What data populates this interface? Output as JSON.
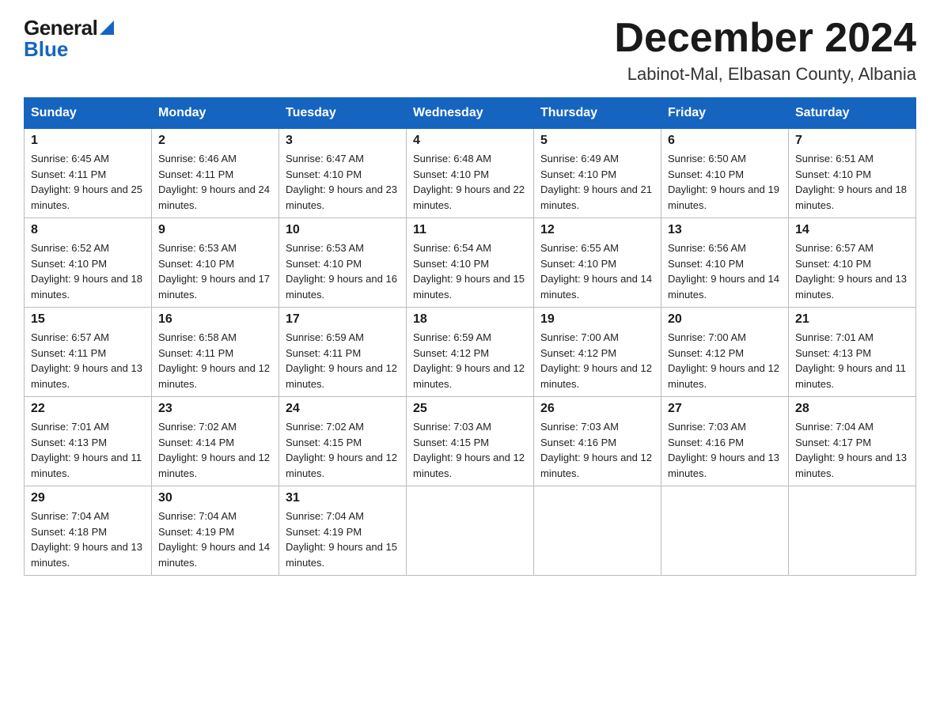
{
  "header": {
    "logo_general": "General",
    "logo_blue": "Blue",
    "month_title": "December 2024",
    "location": "Labinot-Mal, Elbasan County, Albania"
  },
  "calendar": {
    "days_of_week": [
      "Sunday",
      "Monday",
      "Tuesday",
      "Wednesday",
      "Thursday",
      "Friday",
      "Saturday"
    ],
    "weeks": [
      [
        {
          "day": "1",
          "sunrise": "Sunrise: 6:45 AM",
          "sunset": "Sunset: 4:11 PM",
          "daylight": "Daylight: 9 hours and 25 minutes."
        },
        {
          "day": "2",
          "sunrise": "Sunrise: 6:46 AM",
          "sunset": "Sunset: 4:11 PM",
          "daylight": "Daylight: 9 hours and 24 minutes."
        },
        {
          "day": "3",
          "sunrise": "Sunrise: 6:47 AM",
          "sunset": "Sunset: 4:10 PM",
          "daylight": "Daylight: 9 hours and 23 minutes."
        },
        {
          "day": "4",
          "sunrise": "Sunrise: 6:48 AM",
          "sunset": "Sunset: 4:10 PM",
          "daylight": "Daylight: 9 hours and 22 minutes."
        },
        {
          "day": "5",
          "sunrise": "Sunrise: 6:49 AM",
          "sunset": "Sunset: 4:10 PM",
          "daylight": "Daylight: 9 hours and 21 minutes."
        },
        {
          "day": "6",
          "sunrise": "Sunrise: 6:50 AM",
          "sunset": "Sunset: 4:10 PM",
          "daylight": "Daylight: 9 hours and 19 minutes."
        },
        {
          "day": "7",
          "sunrise": "Sunrise: 6:51 AM",
          "sunset": "Sunset: 4:10 PM",
          "daylight": "Daylight: 9 hours and 18 minutes."
        }
      ],
      [
        {
          "day": "8",
          "sunrise": "Sunrise: 6:52 AM",
          "sunset": "Sunset: 4:10 PM",
          "daylight": "Daylight: 9 hours and 18 minutes."
        },
        {
          "day": "9",
          "sunrise": "Sunrise: 6:53 AM",
          "sunset": "Sunset: 4:10 PM",
          "daylight": "Daylight: 9 hours and 17 minutes."
        },
        {
          "day": "10",
          "sunrise": "Sunrise: 6:53 AM",
          "sunset": "Sunset: 4:10 PM",
          "daylight": "Daylight: 9 hours and 16 minutes."
        },
        {
          "day": "11",
          "sunrise": "Sunrise: 6:54 AM",
          "sunset": "Sunset: 4:10 PM",
          "daylight": "Daylight: 9 hours and 15 minutes."
        },
        {
          "day": "12",
          "sunrise": "Sunrise: 6:55 AM",
          "sunset": "Sunset: 4:10 PM",
          "daylight": "Daylight: 9 hours and 14 minutes."
        },
        {
          "day": "13",
          "sunrise": "Sunrise: 6:56 AM",
          "sunset": "Sunset: 4:10 PM",
          "daylight": "Daylight: 9 hours and 14 minutes."
        },
        {
          "day": "14",
          "sunrise": "Sunrise: 6:57 AM",
          "sunset": "Sunset: 4:10 PM",
          "daylight": "Daylight: 9 hours and 13 minutes."
        }
      ],
      [
        {
          "day": "15",
          "sunrise": "Sunrise: 6:57 AM",
          "sunset": "Sunset: 4:11 PM",
          "daylight": "Daylight: 9 hours and 13 minutes."
        },
        {
          "day": "16",
          "sunrise": "Sunrise: 6:58 AM",
          "sunset": "Sunset: 4:11 PM",
          "daylight": "Daylight: 9 hours and 12 minutes."
        },
        {
          "day": "17",
          "sunrise": "Sunrise: 6:59 AM",
          "sunset": "Sunset: 4:11 PM",
          "daylight": "Daylight: 9 hours and 12 minutes."
        },
        {
          "day": "18",
          "sunrise": "Sunrise: 6:59 AM",
          "sunset": "Sunset: 4:12 PM",
          "daylight": "Daylight: 9 hours and 12 minutes."
        },
        {
          "day": "19",
          "sunrise": "Sunrise: 7:00 AM",
          "sunset": "Sunset: 4:12 PM",
          "daylight": "Daylight: 9 hours and 12 minutes."
        },
        {
          "day": "20",
          "sunrise": "Sunrise: 7:00 AM",
          "sunset": "Sunset: 4:12 PM",
          "daylight": "Daylight: 9 hours and 12 minutes."
        },
        {
          "day": "21",
          "sunrise": "Sunrise: 7:01 AM",
          "sunset": "Sunset: 4:13 PM",
          "daylight": "Daylight: 9 hours and 11 minutes."
        }
      ],
      [
        {
          "day": "22",
          "sunrise": "Sunrise: 7:01 AM",
          "sunset": "Sunset: 4:13 PM",
          "daylight": "Daylight: 9 hours and 11 minutes."
        },
        {
          "day": "23",
          "sunrise": "Sunrise: 7:02 AM",
          "sunset": "Sunset: 4:14 PM",
          "daylight": "Daylight: 9 hours and 12 minutes."
        },
        {
          "day": "24",
          "sunrise": "Sunrise: 7:02 AM",
          "sunset": "Sunset: 4:15 PM",
          "daylight": "Daylight: 9 hours and 12 minutes."
        },
        {
          "day": "25",
          "sunrise": "Sunrise: 7:03 AM",
          "sunset": "Sunset: 4:15 PM",
          "daylight": "Daylight: 9 hours and 12 minutes."
        },
        {
          "day": "26",
          "sunrise": "Sunrise: 7:03 AM",
          "sunset": "Sunset: 4:16 PM",
          "daylight": "Daylight: 9 hours and 12 minutes."
        },
        {
          "day": "27",
          "sunrise": "Sunrise: 7:03 AM",
          "sunset": "Sunset: 4:16 PM",
          "daylight": "Daylight: 9 hours and 13 minutes."
        },
        {
          "day": "28",
          "sunrise": "Sunrise: 7:04 AM",
          "sunset": "Sunset: 4:17 PM",
          "daylight": "Daylight: 9 hours and 13 minutes."
        }
      ],
      [
        {
          "day": "29",
          "sunrise": "Sunrise: 7:04 AM",
          "sunset": "Sunset: 4:18 PM",
          "daylight": "Daylight: 9 hours and 13 minutes."
        },
        {
          "day": "30",
          "sunrise": "Sunrise: 7:04 AM",
          "sunset": "Sunset: 4:19 PM",
          "daylight": "Daylight: 9 hours and 14 minutes."
        },
        {
          "day": "31",
          "sunrise": "Sunrise: 7:04 AM",
          "sunset": "Sunset: 4:19 PM",
          "daylight": "Daylight: 9 hours and 15 minutes."
        },
        null,
        null,
        null,
        null
      ]
    ]
  }
}
